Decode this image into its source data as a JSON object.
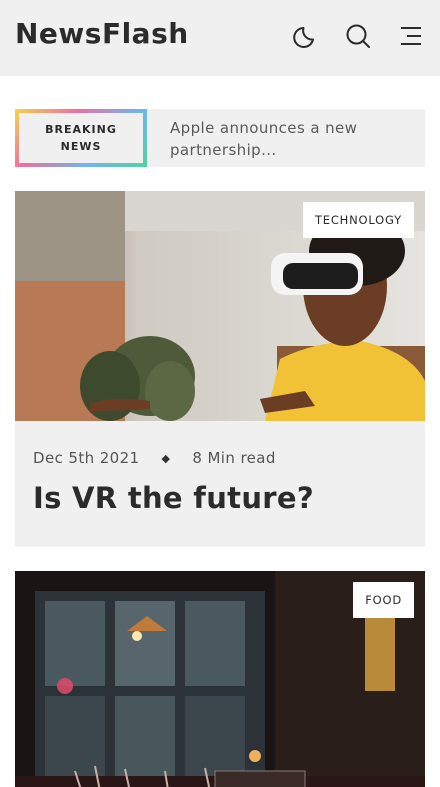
{
  "header": {
    "logo": "NewsFlash",
    "icons": [
      "moon-icon",
      "search-icon",
      "menu-icon"
    ]
  },
  "breaking": {
    "label": "BREAKING NEWS",
    "text": "Apple announces a new partnership..."
  },
  "articles": [
    {
      "tag": "TECHNOLOGY",
      "date": "Dec 5th 2021",
      "read_time": "8 Min read",
      "title": "Is VR the future?",
      "image": "vr-headset-photo"
    },
    {
      "tag": "FOOD",
      "image": "restaurant-photo"
    }
  ],
  "colors": {
    "header_bg": "#f0f0f0",
    "card_bg": "#f0f0f0",
    "text": "#2b2b2b",
    "accent_gradient": [
      "#f5d547",
      "#ef6fa0",
      "#6fb5f0",
      "#4fd39a"
    ]
  }
}
